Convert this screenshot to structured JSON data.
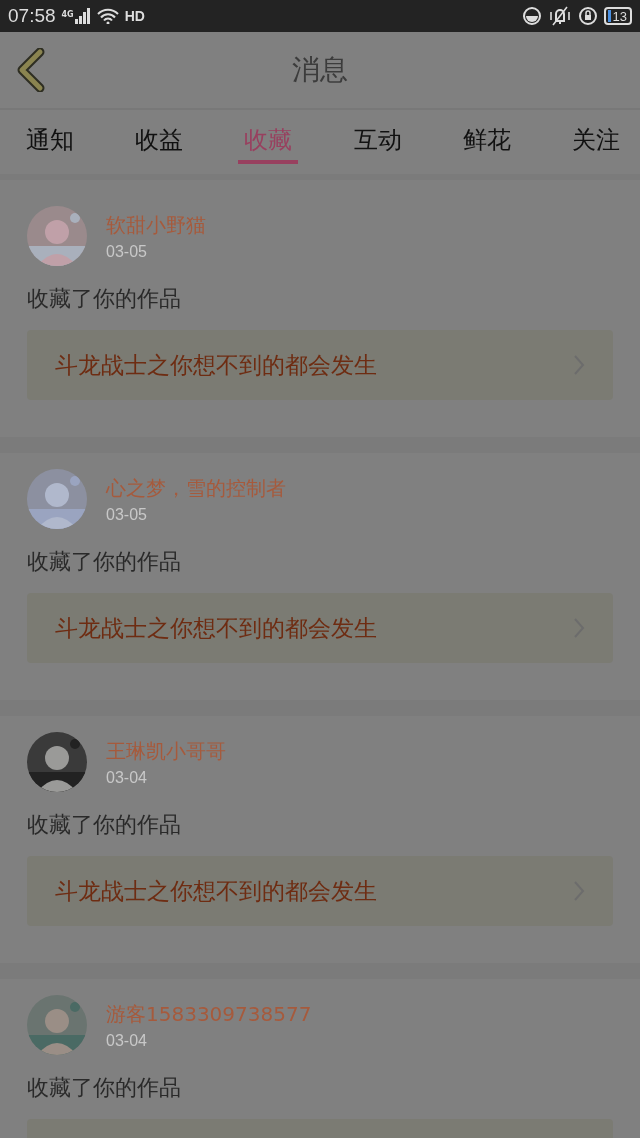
{
  "status_bar": {
    "time": "07:58",
    "network": "4G",
    "hd": "HD",
    "battery": "13"
  },
  "header": {
    "title": "消息"
  },
  "tabs": [
    {
      "label": "通知",
      "selected": false
    },
    {
      "label": "收益",
      "selected": false
    },
    {
      "label": "收藏",
      "selected": true
    },
    {
      "label": "互动",
      "selected": false
    },
    {
      "label": "鲜花",
      "selected": false
    },
    {
      "label": "关注",
      "selected": false
    }
  ],
  "messages": [
    {
      "user": "软甜小野猫",
      "date": "03-05",
      "action": "收藏了你的作品",
      "work_title": "斗龙战士之你想不到的都会发生"
    },
    {
      "user": "心之梦，雪的控制者",
      "date": "03-05",
      "action": "收藏了你的作品",
      "work_title": "斗龙战士之你想不到的都会发生"
    },
    {
      "user": "王琳凯小哥哥",
      "date": "03-04",
      "action": "收藏了你的作品",
      "work_title": "斗龙战士之你想不到的都会发生"
    },
    {
      "user": "游客1583309738577",
      "date": "03-04",
      "action": "收藏了你的作品"
    }
  ]
}
